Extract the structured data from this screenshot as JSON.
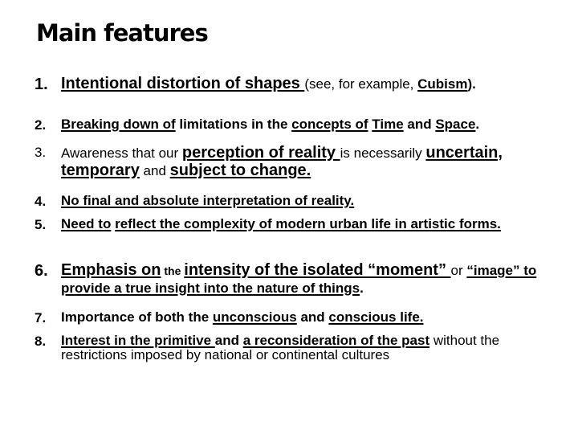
{
  "slide": {
    "title": "Main features",
    "items": [
      {
        "number": "1.",
        "size": "l",
        "segments": [
          {
            "text": "Intentional  distortion of shapes ",
            "b": true,
            "u": true
          },
          {
            "text": "(see, for example, ",
            "b": false,
            "u": false,
            "size": "m"
          },
          {
            "text": "Cubism",
            "b": true,
            "u": true,
            "size": "m"
          },
          {
            "text": ").",
            "b": true,
            "u": false,
            "size": "m"
          }
        ]
      },
      {
        "number": "2.",
        "size": "m",
        "segments": [
          {
            "text": "Breaking down of",
            "b": true,
            "u": true
          },
          {
            "text": " limitations in the ",
            "b": true,
            "u": false
          },
          {
            "text": "concepts of",
            "b": true,
            "u": true
          },
          {
            "text": " ",
            "b": true,
            "u": false
          },
          {
            "text": "Time",
            "b": true,
            "u": true
          },
          {
            "text": " and ",
            "b": true,
            "u": false
          },
          {
            "text": "Space",
            "b": true,
            "u": true
          },
          {
            "text": ".",
            "b": true,
            "u": false
          }
        ]
      },
      {
        "number": "3.",
        "size": "m",
        "number_regular": true,
        "segments": [
          {
            "text": "Awareness that our ",
            "b": false,
            "u": false
          },
          {
            "text": "perception of reality ",
            "b": true,
            "u": true,
            "size": "l"
          },
          {
            "text": "is necessarily ",
            "b": false,
            "u": false
          },
          {
            "text": "uncertain,",
            "b": true,
            "u": true,
            "size": "l"
          },
          {
            "text": " ",
            "b": true,
            "u": false,
            "size": "l"
          },
          {
            "text": "temporary",
            "b": true,
            "u": true,
            "size": "l"
          },
          {
            "text": " and ",
            "b": false,
            "u": false
          },
          {
            "text": "subject to change.",
            "b": true,
            "u": true,
            "size": "l"
          }
        ]
      },
      {
        "number": "4.",
        "size": "m",
        "segments": [
          {
            "text": "No final and absolute interpretation of reality.",
            "b": true,
            "u": true
          }
        ]
      },
      {
        "number": "5.",
        "size": "m",
        "segments": [
          {
            "text": "Need to",
            "b": true,
            "u": true
          },
          {
            "text": " ",
            "b": true,
            "u": false
          },
          {
            "text": "reflect the complexity of modern urban life in artistic forms.",
            "b": true,
            "u": true
          }
        ]
      },
      {
        "number": "6.",
        "size": "l",
        "segments": [
          {
            "text": "Emphasis on",
            "b": true,
            "u": true
          },
          {
            "text": " the ",
            "b": true,
            "u": false,
            "size": "s"
          },
          {
            "text": "intensity of the isolated “moment” ",
            "b": true,
            "u": true
          },
          {
            "text": "or ",
            "b": false,
            "u": false,
            "size": "m"
          },
          {
            "text": "“image” to provide a true insight into the nature of things",
            "b": true,
            "u": true,
            "size": "m"
          },
          {
            "text": ".",
            "b": true,
            "u": false,
            "size": "m"
          }
        ]
      },
      {
        "number": "7.",
        "size": "m",
        "segments": [
          {
            "text": "Importance of both the ",
            "b": true,
            "u": false
          },
          {
            "text": "unconscious",
            "b": true,
            "u": true
          },
          {
            "text": " and ",
            "b": true,
            "u": false
          },
          {
            "text": "conscious life.",
            "b": true,
            "u": true
          }
        ]
      },
      {
        "number": "8.",
        "size": "m",
        "segments": [
          {
            "text": "Interest in the primitive ",
            "b": true,
            "u": true
          },
          {
            "text": "and ",
            "b": true,
            "u": false
          },
          {
            "text": "a reconsideration of the past",
            "b": true,
            "u": true
          },
          {
            "text": " without the restrictions imposed by national or continental cultures",
            "b": false,
            "u": false
          }
        ]
      }
    ]
  }
}
